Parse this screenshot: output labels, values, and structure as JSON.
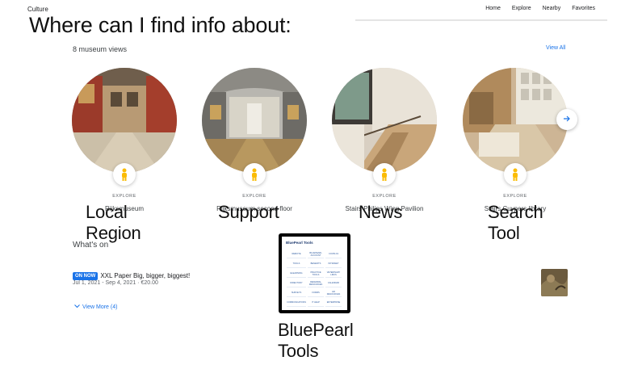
{
  "site": {
    "brand": "Culture",
    "nav": [
      "Home",
      "Explore",
      "Nearby",
      "Favorites"
    ]
  },
  "overlay": {
    "question": "Where can I find info about:",
    "labels": {
      "local_region": "Local Region",
      "support": "Support",
      "news": "News",
      "search_tool": "Search Tool",
      "bluepearl_tools": "BluePearl Tools"
    }
  },
  "museum_views": {
    "count_label": "8 museum views",
    "view_all": "View All",
    "explore_label": "EXPLORE",
    "cards": [
      {
        "title": "Rijksmuseum",
        "scene": "gallery-red"
      },
      {
        "title": "Rijksmuseum second floor",
        "scene": "hall-statue"
      },
      {
        "title": "Stairs Philips Wing Pavilion",
        "scene": "stairs"
      },
      {
        "title": "Stairs Cuypers library",
        "scene": "library"
      }
    ]
  },
  "whats_on": {
    "heading": "What's on",
    "event": {
      "badge": "ON NOW",
      "title": "XXL Paper Big, bigger, biggest!",
      "meta": "Jul 1, 2021 - Sep 4, 2021 · €20.00"
    },
    "view_more": "View More (4)"
  },
  "bluepearl_panel": {
    "heading": "BluePearl Tools",
    "cells": [
      "REMOTE",
      "BLUEPEARL ACCOUNT",
      "COVID-19",
      "TOOLS",
      "BENEFITS",
      "INTRANET",
      "ELEARNING",
      "PRACTICE TOOLS",
      "VETERINARY LINKS",
      "DIRECTORY",
      "REFERRAL RESOURCES",
      "CALENDAR",
      "SURVEYS",
      "FORMS",
      "HR RESOURCES",
      "COMMUNICATIONS",
      "IT HELP",
      "ENTERPRISE"
    ]
  },
  "colors": {
    "accent": "#1a73e8",
    "pegman": "#fbbc04",
    "text_primary": "#202124",
    "text_secondary": "#5f6368"
  },
  "icons": {
    "pegman": "pegman-icon",
    "next": "arrow-right-icon",
    "chevron": "chevron-down-icon"
  }
}
